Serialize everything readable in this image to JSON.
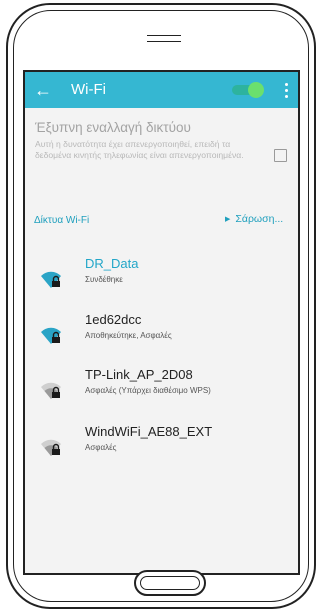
{
  "appbar": {
    "title": "Wi-Fi",
    "back_icon": "arrow-left-icon",
    "toggle_state": "on",
    "menu_icon": "more-vert-icon",
    "color": "#35b7d2"
  },
  "smart_switch": {
    "title": "Έξυπνη εναλλαγή δικτύου",
    "description": "Αυτή η δυνατότητα έχει απενεργοποιηθεί, επειδή τα δεδομένα κινητής τηλεφωνίας είναι απενεργοποιημένα.",
    "checked": false
  },
  "networks": {
    "header": "Δίκτυα Wi-Fi",
    "scan_label": "Σάρωση...",
    "items": [
      {
        "name": "DR_Data",
        "status": "Συνδέθηκε",
        "active": true,
        "secured": true,
        "icon": "wifi-lock-icon"
      },
      {
        "name": "1ed62dcc",
        "status": "Αποθηκεύτηκε, Ασφαλές",
        "active": false,
        "secured": true,
        "icon": "wifi-lock-icon"
      },
      {
        "name": "TP-Link_AP_2D08",
        "status": "Ασφαλές (Υπάρχει διαθέσιμο WPS)",
        "active": false,
        "secured": true,
        "icon": "wifi-lock-icon"
      },
      {
        "name": "WindWiFi_AE88_EXT",
        "status": "Ασφαλές",
        "active": false,
        "secured": true,
        "icon": "wifi-lock-icon"
      }
    ]
  },
  "colors": {
    "accent": "#1e9fbd",
    "wifi_strong": "#2aa4c6",
    "wifi_weak": "#9a9a9a",
    "toggle_on": "#6be06d"
  }
}
